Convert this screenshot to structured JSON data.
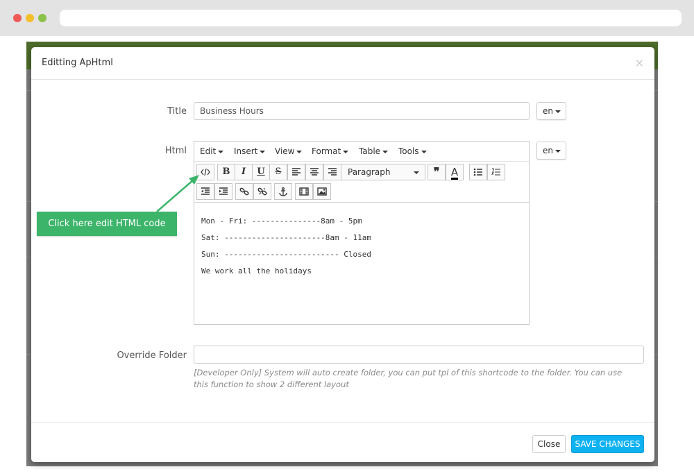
{
  "modal": {
    "title": "Editting ApHtml",
    "close_icon": "×"
  },
  "form": {
    "title_label": "Title",
    "title_value": "Business Hours",
    "title_lang": "en",
    "html_label": "Html",
    "html_lang": "en",
    "override_label": "Override Folder",
    "override_value": "",
    "override_help": "[Developer Only] System will auto create folder, you can put tpl of this shortcode to the folder. You can use this function to show 2 different layout"
  },
  "editor": {
    "menus": [
      "Edit",
      "Insert",
      "View",
      "Format",
      "Table",
      "Tools"
    ],
    "format_select": "Paragraph",
    "icons": [
      "code-icon",
      "bold-icon",
      "italic-icon",
      "underline-icon",
      "strikethrough-icon",
      "align-left-icon",
      "align-center-icon",
      "align-right-icon",
      "blockquote-icon",
      "text-color-icon",
      "bullet-list-icon",
      "numbered-list-icon",
      "outdent-icon",
      "indent-icon",
      "link-icon",
      "unlink-icon",
      "anchor-icon",
      "media-icon",
      "image-icon"
    ],
    "content_lines": [
      "Mon - Fri: ---------------8am - 5pm",
      "Sat: ----------------------8am - 11am",
      "Sun: ------------------------- Closed",
      "We work all the holidays"
    ]
  },
  "footer": {
    "close_label": "Close",
    "save_label": "SAVE CHANGES"
  },
  "callout": {
    "text": "Click here edit HTML code"
  },
  "colors": {
    "callout": "#3cb46a",
    "save_button": "#0fb2f0",
    "backdrop": "#7b7b7b"
  }
}
